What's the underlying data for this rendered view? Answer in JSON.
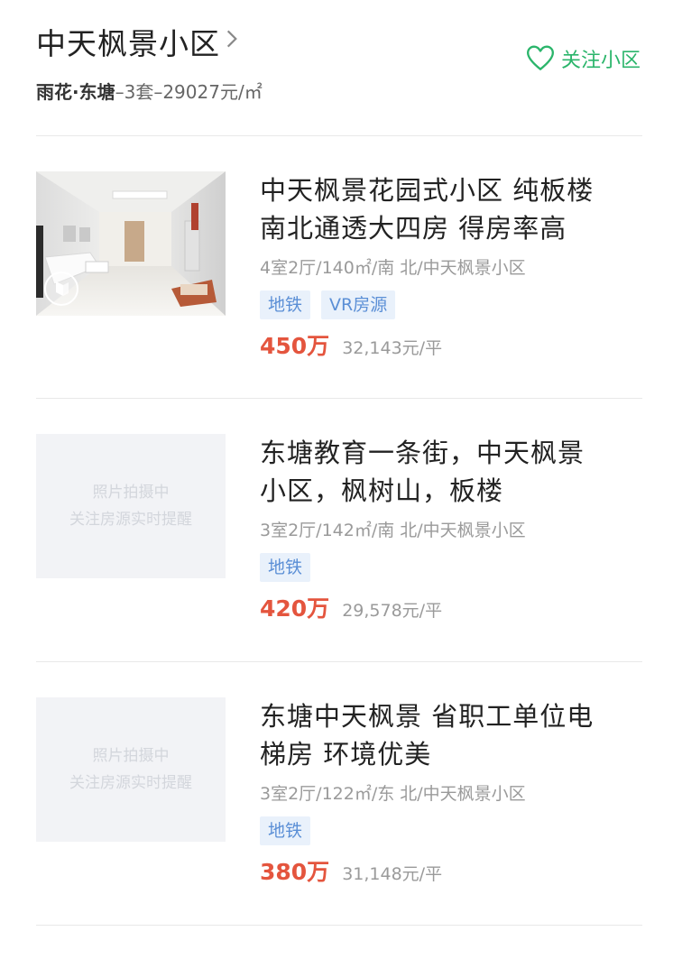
{
  "community": {
    "title": "中天枫景小区",
    "district": "雨花·东塘",
    "summary": "–3套–29027元/㎡",
    "follow_label": "关注小区"
  },
  "placeholder": {
    "line1": "照片拍摄中",
    "line2": "关注房源实时提醒"
  },
  "listings": [
    {
      "title_line1": "中天枫景花园式小区 纯板楼",
      "title_line2": "南北通透大四房 得房率高",
      "meta": "4室2厅/140㎡/南 北/中天枫景小区",
      "tags": [
        "地铁",
        "VR房源"
      ],
      "price": "450万",
      "unit_price": "32,143元/平"
    },
    {
      "title_line1": "东塘教育一条街，中天枫景",
      "title_line2": "小区，枫树山，板楼",
      "meta": "3室2厅/142㎡/南 北/中天枫景小区",
      "tags": [
        "地铁"
      ],
      "price": "420万",
      "unit_price": "29,578元/平"
    },
    {
      "title_line1": "东塘中天枫景 省职工单位电",
      "title_line2": "梯房 环境优美",
      "meta": "3室2厅/122㎡/东 北/中天枫景小区",
      "tags": [
        "地铁"
      ],
      "price": "380万",
      "unit_price": "31,148元/平"
    }
  ],
  "colors": {
    "accent_green": "#2bb56b",
    "price_red": "#e4553e",
    "tag_blue": "#5b8fd6"
  },
  "icons": [
    "chevron-right-icon",
    "heart-outline-icon",
    "vr-play-icon"
  ]
}
